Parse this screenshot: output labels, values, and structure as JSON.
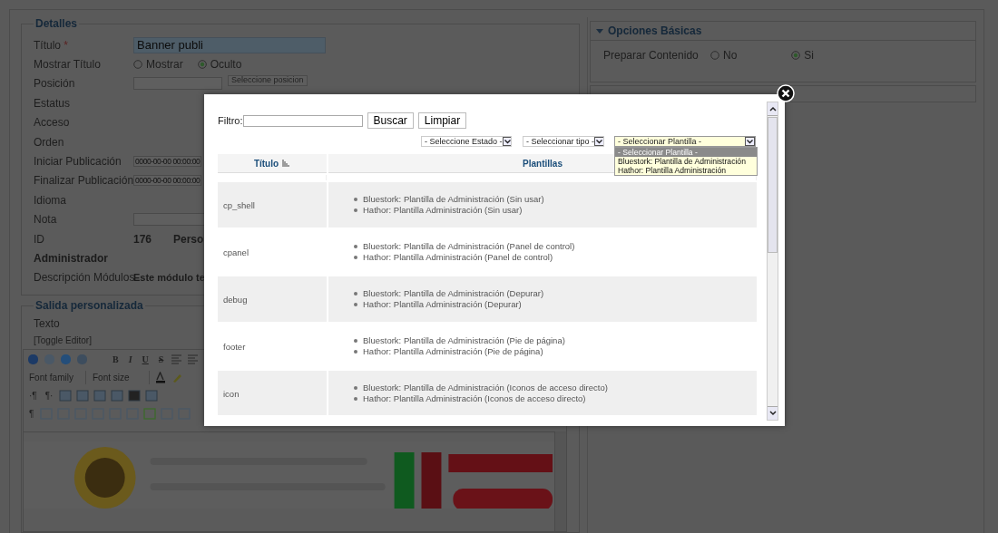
{
  "details": {
    "legend": "Detalles",
    "fields": [
      {
        "kind": "title_input",
        "label": "Título",
        "required_mark": "*",
        "value": "Banner publi"
      },
      {
        "kind": "radio",
        "label": "Mostrar Título",
        "options": [
          {
            "label": "Mostrar",
            "selected": false
          },
          {
            "label": "Oculto",
            "selected": true
          }
        ]
      },
      {
        "kind": "position",
        "label": "Posición",
        "button": "Seleccione posicion"
      },
      {
        "kind": "empty",
        "label": "Estatus"
      },
      {
        "kind": "empty",
        "label": "Acceso"
      },
      {
        "kind": "empty",
        "label": "Orden"
      },
      {
        "kind": "date",
        "label": "Iniciar Publicación",
        "value": "0000-00-00 00:00:00"
      },
      {
        "kind": "date",
        "label": "Finalizar Publicación",
        "value": "0000-00-00 00:00:00"
      },
      {
        "kind": "empty",
        "label": "Idioma"
      },
      {
        "kind": "input",
        "label": "Nota"
      },
      {
        "kind": "id",
        "label": "ID",
        "value": "176",
        "extra": "Perso"
      },
      {
        "kind": "heading",
        "label": "Administrador"
      },
      {
        "kind": "bold_text",
        "label": "Descripción Módulos",
        "value": "Este módulo te"
      }
    ]
  },
  "custom_output": {
    "legend": "Salida personalizada",
    "label": "Texto",
    "toggle": "[Toggle Editor]",
    "format_buttons": [
      "B",
      "I",
      "U",
      "S"
    ],
    "font_selects": [
      "Font family",
      "Font size"
    ],
    "paragraph_marks": [
      "·¶",
      "¶·"
    ],
    "show_marks": "¶",
    "content": {
      "kind": "picture"
    }
  },
  "basic_options": {
    "legend": "Opciones Básicas",
    "expanded": true,
    "fields": [
      {
        "label": "Preparar Contenido",
        "options": [
          {
            "label": "No",
            "selected": false
          },
          {
            "label": "Si",
            "selected": true
          }
        ]
      }
    ]
  },
  "modal": {
    "filter_label": "Filtro:",
    "buttons": [
      "Buscar",
      "Limpiar"
    ],
    "selects": [
      {
        "value": "- Seleccione Estado -",
        "open": false
      },
      {
        "value": "- Seleccionar tipo -",
        "open": false
      },
      {
        "value": "- Seleccionar Plantilla -",
        "open": true,
        "options": [
          {
            "label": "- Seleccionar Plantilla -",
            "selected": true
          },
          {
            "label": "Bluestork: Plantilla de Administración",
            "selected": false
          },
          {
            "label": "Hathor: Plantilla Administración",
            "selected": false
          }
        ]
      }
    ],
    "columns": [
      {
        "label": "Título",
        "sorted": true
      },
      {
        "label": "Plantillas",
        "sorted": false
      }
    ],
    "rows": [
      {
        "title": "cp_shell",
        "templates": [
          "Bluestork: Plantilla de Administración (Sin usar)",
          "Hathor: Plantilla Administración (Sin usar)"
        ]
      },
      {
        "title": "cpanel",
        "templates": [
          "Bluestork: Plantilla de Administración (Panel de control)",
          "Hathor: Plantilla Administración (Panel de control)"
        ]
      },
      {
        "title": "debug",
        "templates": [
          "Bluestork: Plantilla de Administración (Depurar)",
          "Hathor: Plantilla Administración (Depurar)"
        ]
      },
      {
        "title": "footer",
        "templates": [
          "Bluestork: Plantilla de Administración (Pie de página)",
          "Hathor: Plantilla Administración (Pie de página)"
        ]
      },
      {
        "title": "icon",
        "templates": [
          "Bluestork: Plantilla de Administración (Iconos de acceso directo)",
          "Hathor: Plantilla Administración (Iconos de acceso directo)"
        ]
      }
    ]
  }
}
